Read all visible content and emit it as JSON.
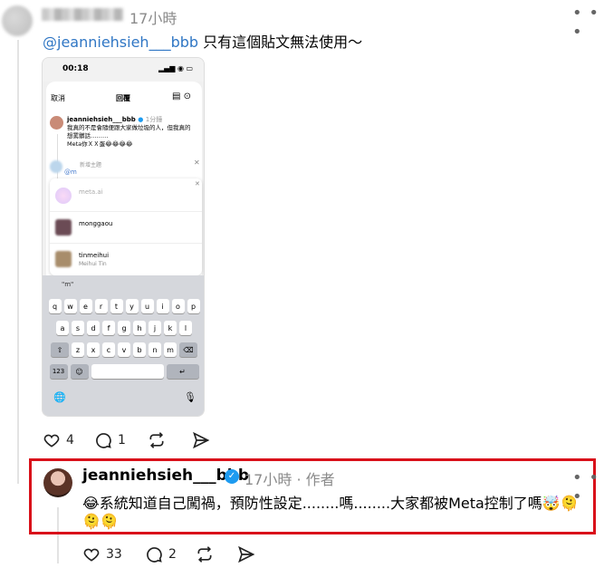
{
  "top_comment": {
    "time": "17小時",
    "mention": "@jeanniehsieh___bbb",
    "text": " 只有這個貼文無法使用～",
    "actions": {
      "likes": "4",
      "replies": "1"
    }
  },
  "phone": {
    "status_time": "00:18",
    "cancel": "取消",
    "title": "回覆",
    "post_user": "jeanniehsieh___bbb",
    "post_time": "1分鐘",
    "post_text": "我真的不是會隨便跟大家做垃圾的人，但我真的想罵髒話………",
    "post_text2": "Meta你ＸＸ蛋😂😂😂😂",
    "topic_hint": "新增主題",
    "input_text": "@m",
    "suggestions": [
      {
        "name": "meta.ai",
        "sub": ""
      },
      {
        "name": "monggaou",
        "sub": ""
      },
      {
        "name": "tinmeihui",
        "sub": "Meihui Tin"
      }
    ],
    "kb_suggestion": "\"m\"",
    "kb_rows": [
      [
        "q",
        "w",
        "e",
        "r",
        "t",
        "y",
        "u",
        "i",
        "o",
        "p"
      ],
      [
        "a",
        "s",
        "d",
        "f",
        "g",
        "h",
        "j",
        "k",
        "l"
      ],
      [
        "⇧",
        "z",
        "x",
        "c",
        "v",
        "b",
        "n",
        "m",
        "⌫"
      ]
    ],
    "kb_123": "123",
    "kb_emoji": "☺",
    "kb_return": "↵",
    "globe": "🌐",
    "mic": "🎙"
  },
  "reply": {
    "user": "jeanniehsieh___bbb",
    "time": "17小時 · 作者",
    "text": "😂系統知道自己闖禍，預防性設定........嗎........大家都被Meta控制了嗎🤯🫠",
    "emoji_line": "🫠🫠",
    "actions": {
      "likes": "33",
      "replies": "2"
    }
  },
  "icons": [
    "more-icon",
    "heart-icon",
    "comment-icon",
    "repost-icon",
    "share-icon",
    "verified-icon"
  ]
}
